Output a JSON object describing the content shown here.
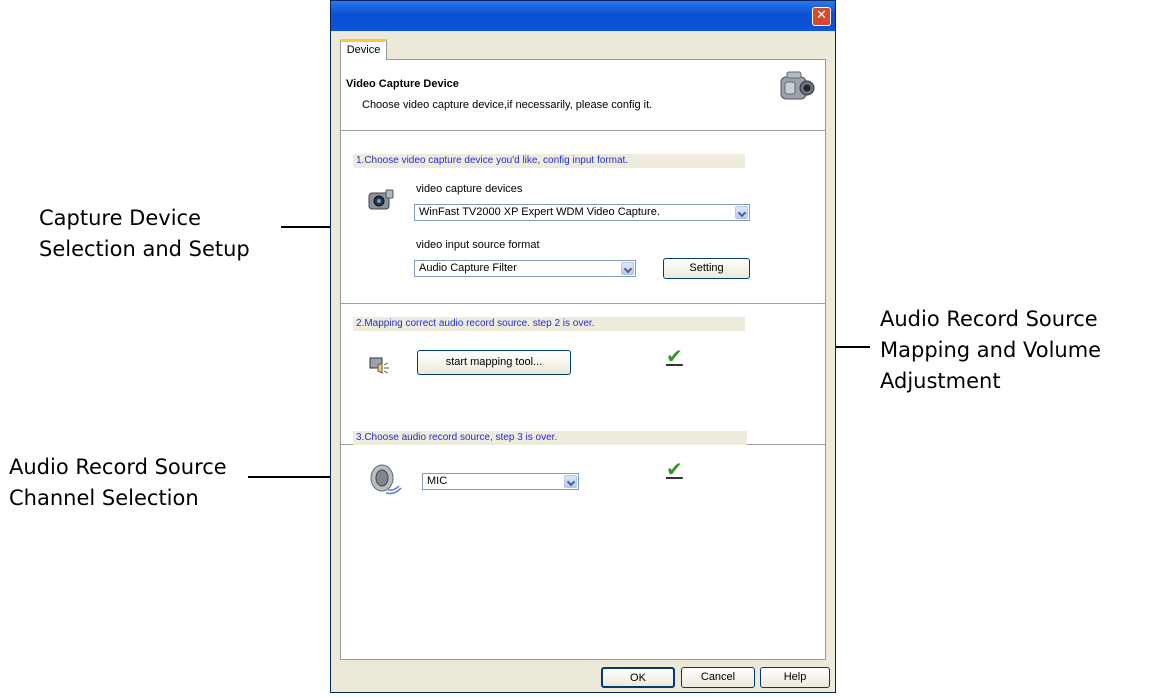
{
  "callouts": {
    "capture": {
      "line1": "Capture Device",
      "line2": "Selection and Setup"
    },
    "mapping": {
      "line1": "Audio Record Source",
      "line2": "Mapping and Volume",
      "line3": "Adjustment"
    },
    "channel": {
      "line1": "Audio Record Source",
      "line2": "Channel Selection"
    }
  },
  "window": {
    "close_icon": "close-icon",
    "tab_label": "Device",
    "header_title": "Video Capture Device",
    "header_subtitle": "Choose video capture device,if  necessarily, please config it."
  },
  "step1": {
    "heading": "1.Choose video capture device you'd like, config input format.",
    "devices_label": "video capture devices",
    "device_value": "WinFast TV2000 XP Expert WDM Video Capture.",
    "format_label": "video input source format",
    "format_value": "Audio Capture Filter",
    "setting_button": "Setting"
  },
  "step2": {
    "heading": "2.Mapping correct audio record source. step 2 is over.",
    "mapping_button": "start mapping tool...",
    "status_icon": "check-icon"
  },
  "step3": {
    "heading": "3.Choose audio record source, step 3 is over.",
    "source_value": "MIC",
    "status_icon": "check-icon"
  },
  "footer": {
    "ok": "OK",
    "cancel": "Cancel",
    "help": "Help"
  },
  "colors": {
    "titlebar": "#0a4fd0",
    "step_text": "#1f2fd3",
    "check": "#2e9b22"
  }
}
